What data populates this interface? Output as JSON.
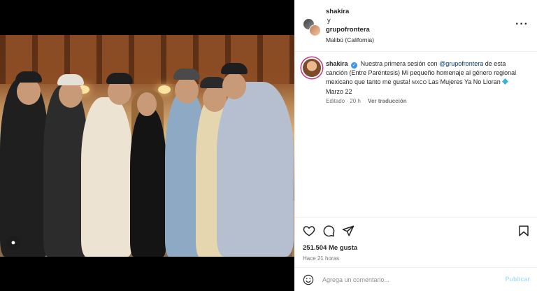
{
  "header": {
    "user1": "shakira",
    "conjunction": "y",
    "user2": "grupofrontera",
    "location": "Malibú (California)",
    "more_icon": "more-options-icon"
  },
  "caption": {
    "username": "shakira",
    "text_before_mention": "Nuestra primera sesión con ",
    "mention": "@grupofrontera",
    "text_after_mention": " de esta canción (Entre Paréntesis) Mi pequeño homenaje al género regional mexicano que tanto me gusta! ",
    "flag": "MXCO",
    "song": " Las Mujeres Ya No Lloran ",
    "date": " Marzo 22",
    "edited": "Editado · 20 h",
    "translation": "Ver traducción"
  },
  "actions": {
    "likes": "251.504 Me gusta",
    "ago": "Hace 21 horas"
  },
  "comment": {
    "placeholder": "Agrega un comentario...",
    "publish": "Publicar"
  },
  "colors": {
    "verified": "#3897f0",
    "mention": "#00376b",
    "publish_disabled": "#b2dffc"
  }
}
